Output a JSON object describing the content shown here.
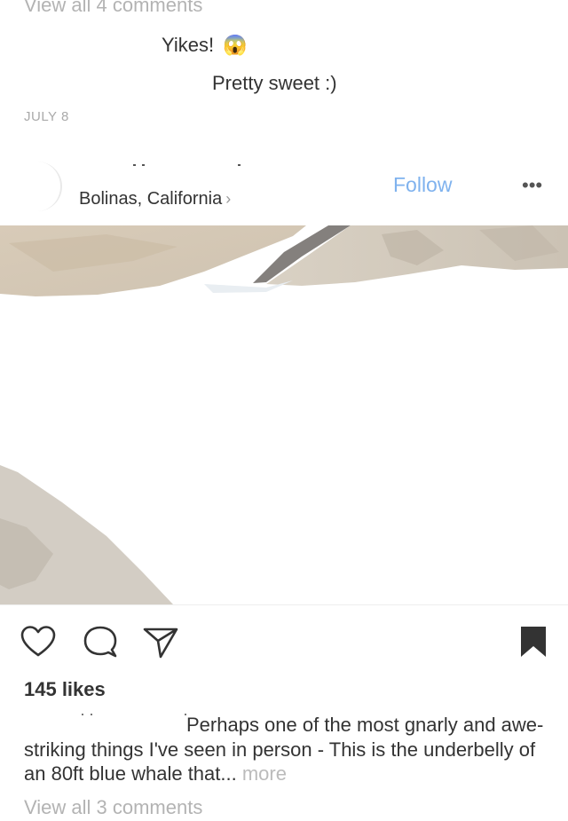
{
  "previous_post": {
    "view_comments_label": "View all 4 comments",
    "comments": [
      {
        "text": "Yikes!",
        "emoji": "😱"
      },
      {
        "text": "Pretty sweet :)"
      }
    ],
    "date": "JULY 8"
  },
  "post": {
    "location": "Bolinas, California",
    "location_chevron": "›",
    "follow_label": "Follow",
    "more_label": "•••",
    "likes": "145 likes",
    "caption": "Perhaps one of the most gnarly and awe-striking things I've seen in person - This is the underbelly of an 80ft blue whale that...",
    "caption_more": "more",
    "view_comments_label": "View all 3 comments"
  },
  "colors": {
    "follow": "#7fb2ee",
    "text": "#333333",
    "muted": "#b3b3b3",
    "sand": "#d9cfc0"
  },
  "icons": [
    "heart-icon",
    "comment-icon",
    "share-icon",
    "bookmark-icon",
    "chevron-right-icon",
    "more-icon"
  ]
}
